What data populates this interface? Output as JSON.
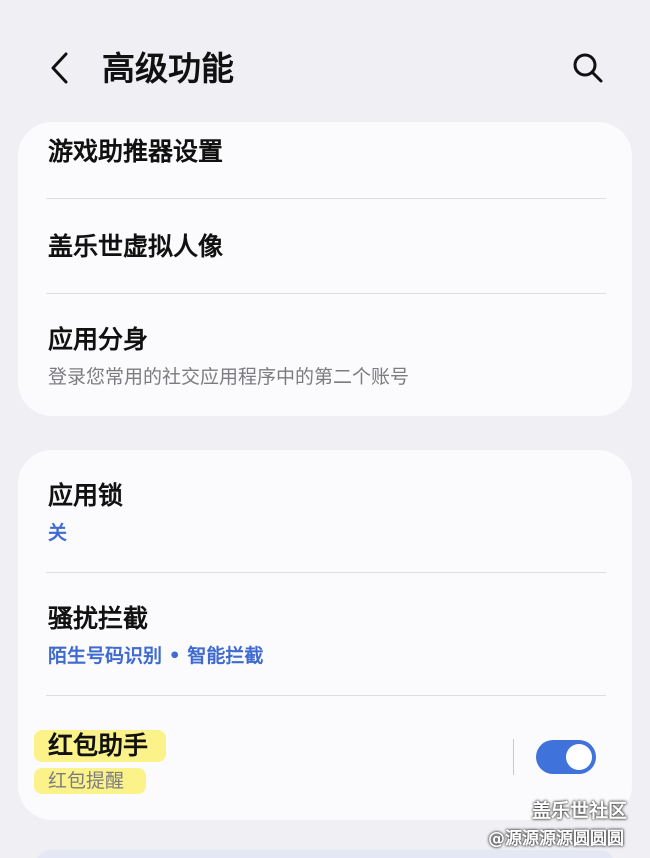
{
  "header": {
    "title": "高级功能",
    "back_icon": "chevron-left-icon",
    "search_icon": "search-icon"
  },
  "card1": {
    "items": [
      {
        "title": "游戏助推器设置"
      },
      {
        "title": "盖乐世虚拟人像"
      },
      {
        "title": "应用分身",
        "subtitle": "登录您常用的社交应用程序中的第二个账号"
      }
    ]
  },
  "card2": {
    "items": [
      {
        "title": "应用锁",
        "subtitle": "关"
      },
      {
        "title": "骚扰拦截",
        "subtitle": "陌生号码识别 • 智能拦截"
      },
      {
        "title": "红包助手",
        "subtitle": "红包提醒",
        "toggle_on": true
      }
    ]
  },
  "watermark": {
    "line1": "盖乐世社区",
    "line2": "@源源源源圆圆圆"
  },
  "colors": {
    "background": "#efeff4",
    "card": "#fbfbfd",
    "accent_blue": "#3f6bd0",
    "toggle_on": "#3f73db",
    "highlight": "#fbf38a"
  }
}
